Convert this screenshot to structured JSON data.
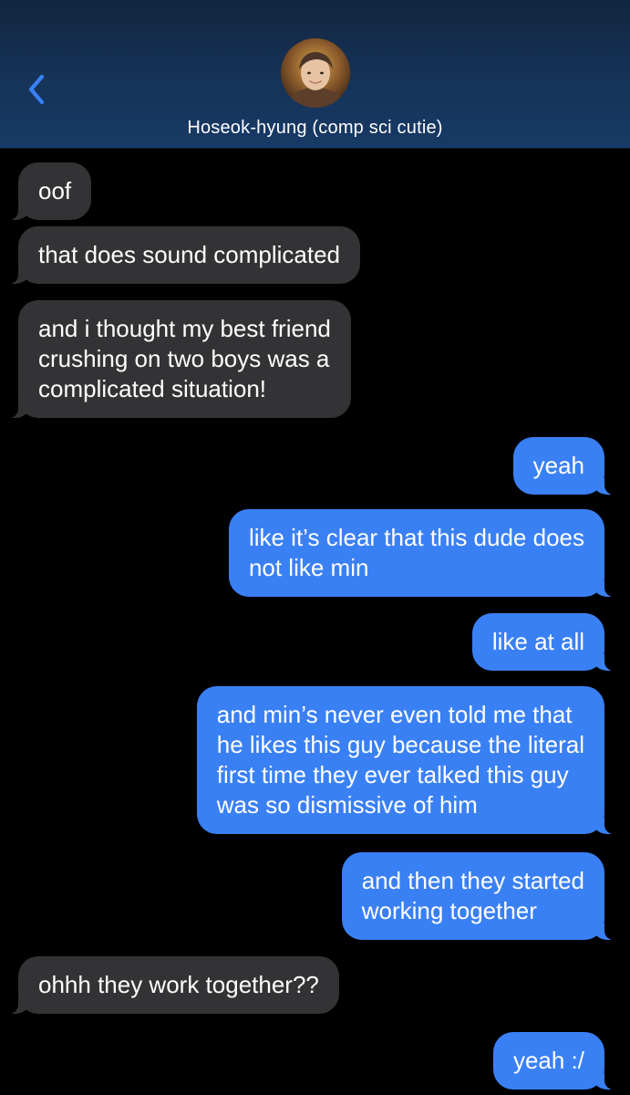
{
  "header": {
    "contact_name": "Hoseok-hyung (comp sci cutie)",
    "back_icon": "chevron-left-icon",
    "accent_color": "#3a80f5"
  },
  "messages": [
    {
      "sender": "them",
      "text": "oof"
    },
    {
      "sender": "them",
      "text": "that does sound complicated"
    },
    {
      "sender": "them",
      "text": "and i thought my best friend\ncrushing on two boys was a\ncomplicated situation!"
    },
    {
      "sender": "me",
      "text": "yeah"
    },
    {
      "sender": "me",
      "text": "like it’s clear that this dude does\nnot like min"
    },
    {
      "sender": "me",
      "text": "like at all"
    },
    {
      "sender": "me",
      "text": "and min’s never even told me that\nhe likes this guy because the literal\nfirst time they ever talked this guy\nwas so dismissive of him"
    },
    {
      "sender": "me",
      "text": "and then they started\nworking together"
    },
    {
      "sender": "them",
      "text": "ohhh they work together??"
    },
    {
      "sender": "me",
      "text": "yeah :/"
    }
  ]
}
